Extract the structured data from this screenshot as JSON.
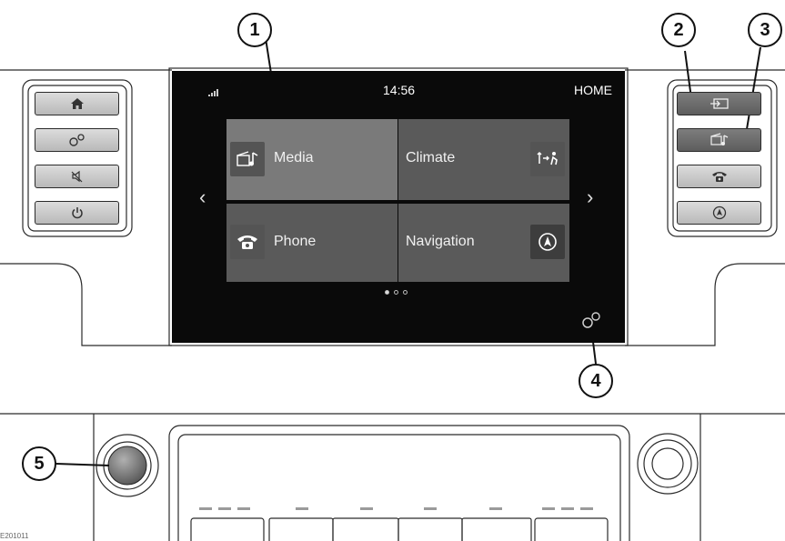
{
  "screen": {
    "clock": "14:56",
    "home_label": "HOME",
    "tiles": [
      {
        "label": "Media",
        "icon": "media-icon",
        "color": "#7a7a7a"
      },
      {
        "label": "Climate",
        "icon": "climate-icon",
        "color": "#5a5a5a"
      },
      {
        "label": "Phone",
        "icon": "phone-icon",
        "color": "#5a5a5a"
      },
      {
        "label": "Navigation",
        "icon": "navigation-icon",
        "color": "#5a5a5a"
      }
    ],
    "prev_arrow": "‹",
    "next_arrow": "›",
    "page_dots": [
      true,
      false,
      false
    ]
  },
  "left_buttons": [
    "home-icon",
    "settings-icon",
    "mute-icon",
    "power-icon"
  ],
  "right_buttons": [
    "source-icon",
    "media-icon",
    "phone-icon",
    "navigation-icon"
  ],
  "callouts": [
    "1",
    "2",
    "3",
    "4",
    "5"
  ],
  "figure_code": "E201011",
  "colors": {
    "line": "#2b2b2b",
    "screen": "#0a0a0a",
    "highlight_tile": "#7a7a7a",
    "tile": "#5a5a5a"
  }
}
